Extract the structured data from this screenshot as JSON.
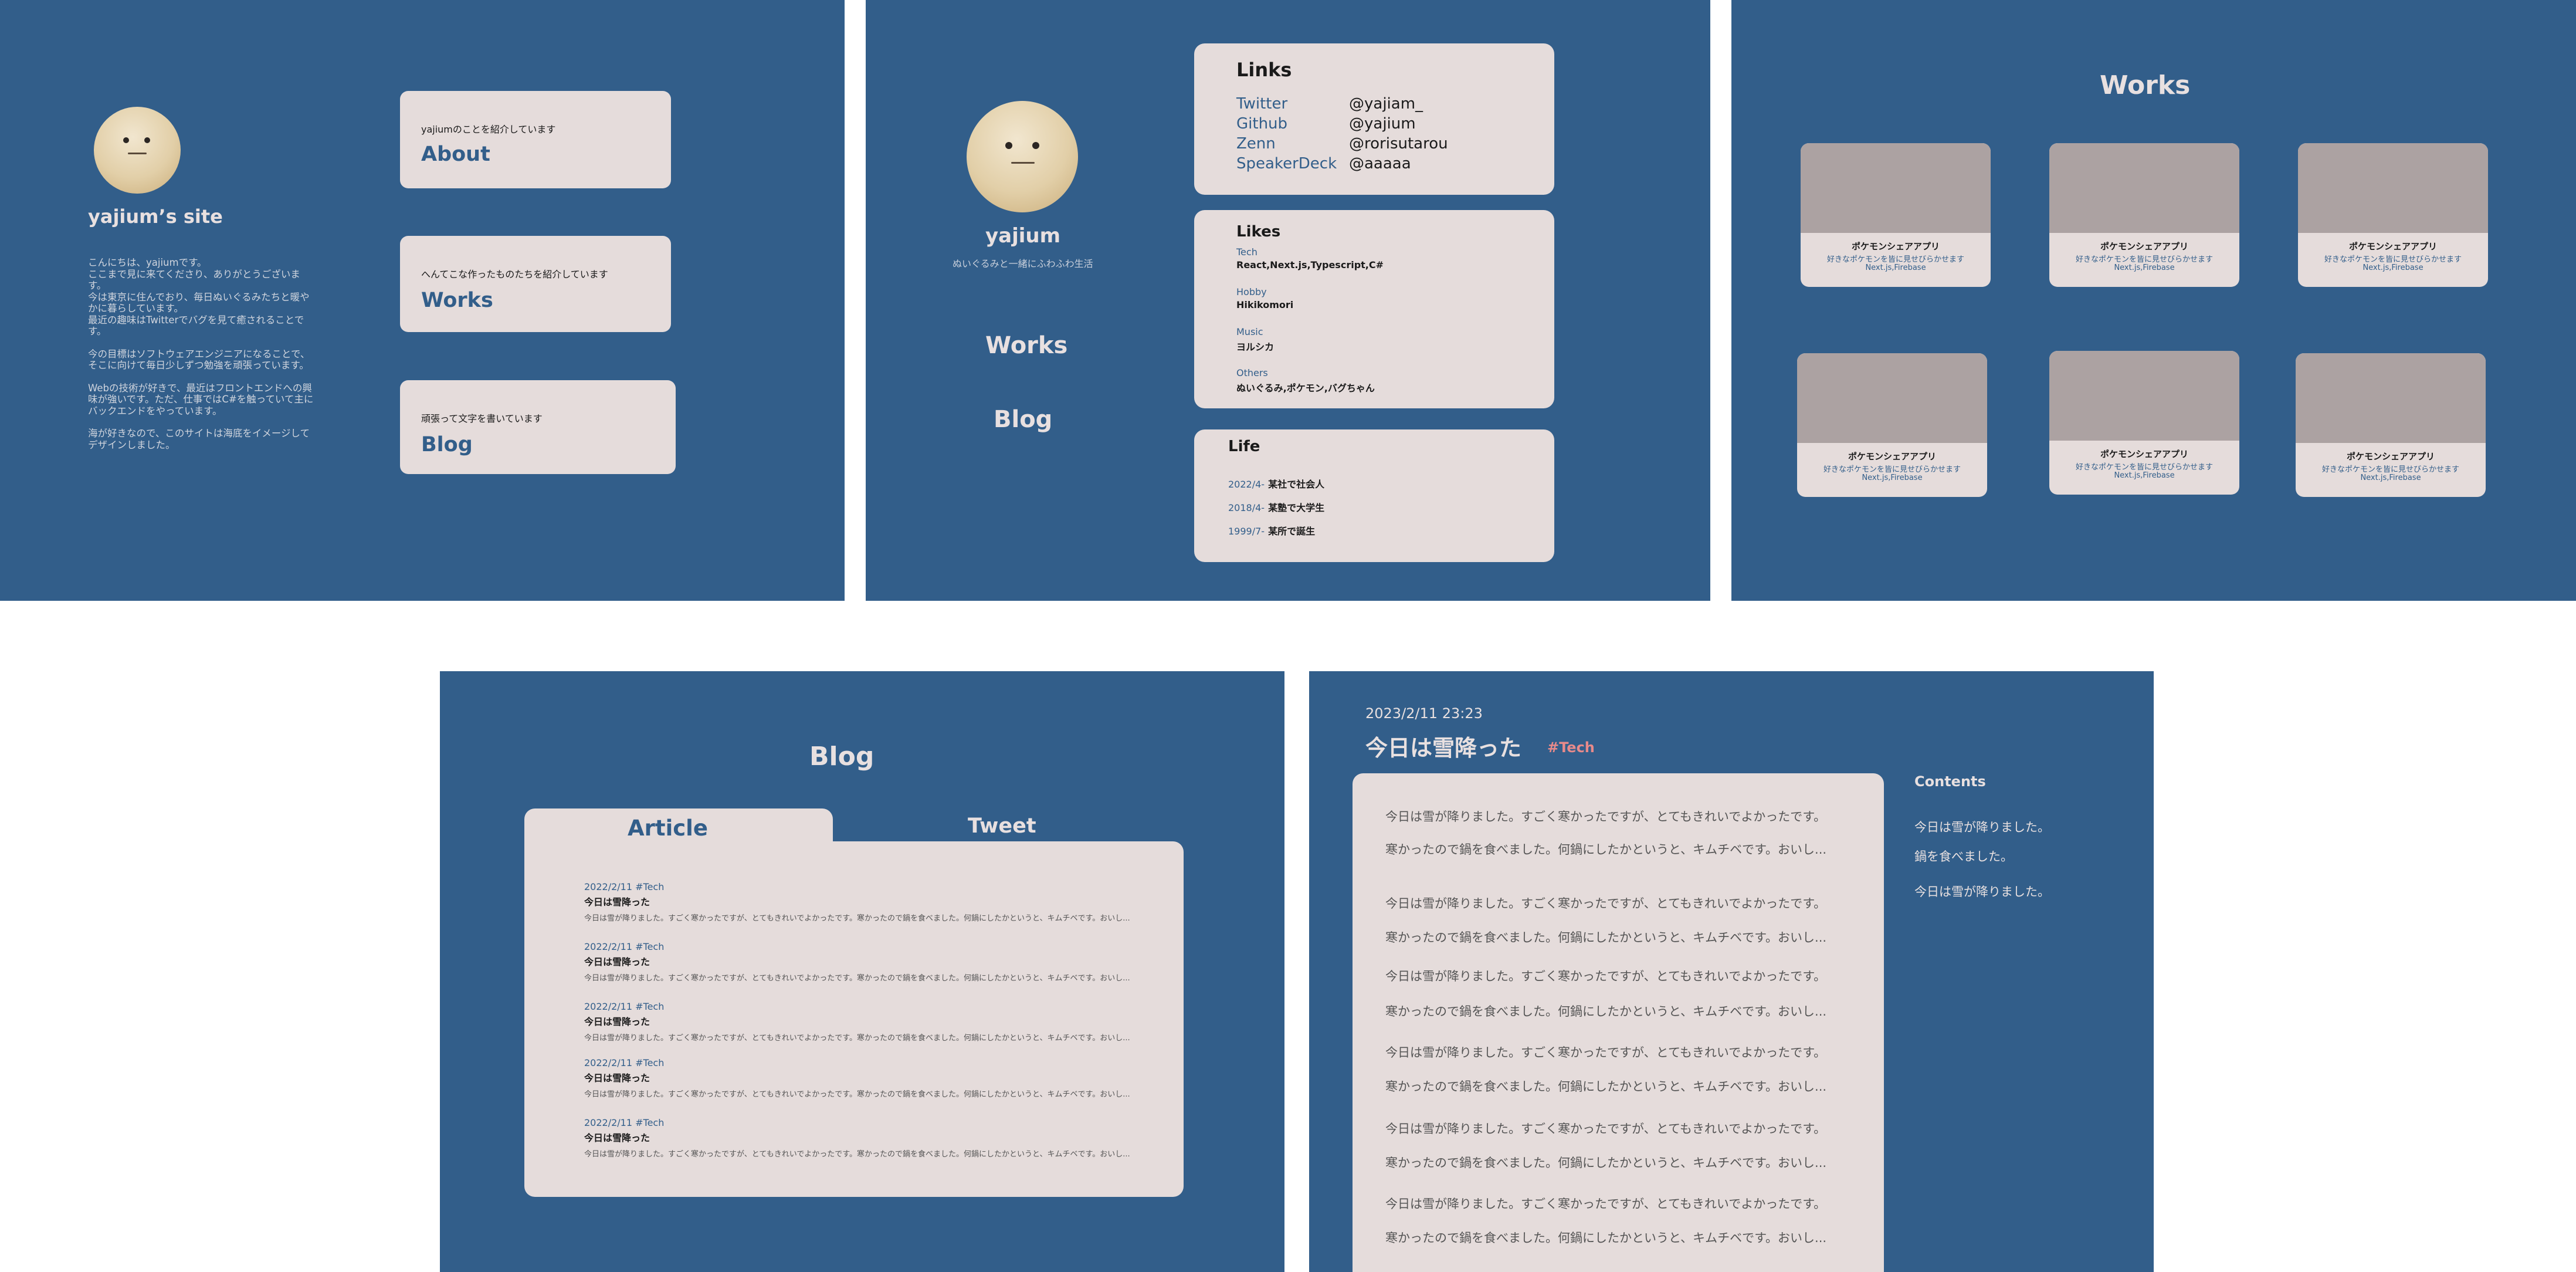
{
  "home": {
    "site_title": "yajium’s site",
    "intro": [
      "こんにちは、yajiumです。\nここまで見に来てくださり、ありがとうございます。\n今は東京に住んでおり、毎日ぬいぐるみたちと暖やかに暮らしています。\n最近の趣味はTwitterでバグを見て癒されることです。",
      "今の目標はソフトウェアエンジニアになることで、そこに向けて毎日少しずつ勉強を頑張っています。",
      "Webの技術が好きで、最近はフロントエンドへの興味が強いです。ただ、仕事ではC#を触っていて主にバックエンドをやっています。",
      "海が好きなので、このサイトは海底をイメージしてデザインしました。"
    ],
    "nav": [
      {
        "sub": "yajiumのことを紹介しています",
        "label": "About"
      },
      {
        "sub": "へんてこな作ったものたちを紹介しています",
        "label": "Works"
      },
      {
        "sub": "頑張って文字を書いています",
        "label": "Blog"
      }
    ]
  },
  "about": {
    "name": "yajium",
    "tagline": "ぬいぐるみと一緒にふわふわ生活",
    "nav": [
      "Works",
      "Blog"
    ],
    "links_title": "Links",
    "links": [
      {
        "name": "Twitter",
        "value": "@yajiam_"
      },
      {
        "name": "Github",
        "value": "@yajium"
      },
      {
        "name": "Zenn",
        "value": "@rorisutarou"
      },
      {
        "name": "SpeakerDeck",
        "value": "@aaaaa"
      }
    ],
    "likes_title": "Likes",
    "likes": [
      {
        "cat": "Tech",
        "value": "React,Next.js,Typescript,C#"
      },
      {
        "cat": "Hobby",
        "value": "Hikikomori"
      },
      {
        "cat": "Music",
        "value": "ヨルシカ"
      },
      {
        "cat": "Others",
        "value": "ぬいぐるみ,ポケモン,バグちゃん"
      }
    ],
    "life_title": "Life",
    "life": [
      {
        "date": "2022/4-",
        "text": "某社で社会人"
      },
      {
        "date": "2018/4-",
        "text": "某塾で大学生"
      },
      {
        "date": "1999/7-",
        "text": "某所で誕生"
      }
    ]
  },
  "works": {
    "title": "Works",
    "items": [
      {
        "title": "ポケモンシェアアプリ",
        "desc": "好きなポケモンを皆に見せびらかせます",
        "tech": "Next.js,Firebase"
      },
      {
        "title": "ポケモンシェアアプリ",
        "desc": "好きなポケモンを皆に見せびらかせます",
        "tech": "Next.js,Firebase"
      },
      {
        "title": "ポケモンシェアアプリ",
        "desc": "好きなポケモンを皆に見せびらかせます",
        "tech": "Next.js,Firebase"
      },
      {
        "title": "ポケモンシェアアプリ",
        "desc": "好きなポケモンを皆に見せびらかせます",
        "tech": "Next.js,Firebase"
      },
      {
        "title": "ポケモンシェアアプリ",
        "desc": "好きなポケモンを皆に見せびらかせます",
        "tech": "Next.js,Firebase"
      },
      {
        "title": "ポケモンシェアアプリ",
        "desc": "好きなポケモンを皆に見せびらかせます",
        "tech": "Next.js,Firebase"
      }
    ]
  },
  "blog": {
    "title": "Blog",
    "tabs": [
      "Article",
      "Tweet"
    ],
    "articles": [
      {
        "meta": "2022/2/11 #Tech",
        "title": "今日は雪降った",
        "excerpt": "今日は雪が降りました。すごく寒かったですが、とてもきれいでよかったです。寒かったので鍋を食べました。何鍋にしたかというと、キムチベです。おいし..."
      },
      {
        "meta": "2022/2/11 #Tech",
        "title": "今日は雪降った",
        "excerpt": "今日は雪が降りました。すごく寒かったですが、とてもきれいでよかったです。寒かったので鍋を食べました。何鍋にしたかというと、キムチベです。おいし..."
      },
      {
        "meta": "2022/2/11 #Tech",
        "title": "今日は雪降った",
        "excerpt": "今日は雪が降りました。すごく寒かったですが、とてもきれいでよかったです。寒かったので鍋を食べました。何鍋にしたかというと、キムチベです。おいし..."
      },
      {
        "meta": "2022/2/11 #Tech",
        "title": "今日は雪降った",
        "excerpt": "今日は雪が降りました。すごく寒かったですが、とてもきれいでよかったです。寒かったので鍋を食べました。何鍋にしたかというと、キムチベです。おいし..."
      },
      {
        "meta": "2022/2/11 #Tech",
        "title": "今日は雪降った",
        "excerpt": "今日は雪が降りました。すごく寒かったですが、とてもきれいでよかったです。寒かったので鍋を食べました。何鍋にしたかというと、キムチベです。おいし..."
      }
    ]
  },
  "post": {
    "datetime": "2023/2/11  23:23",
    "title": "今日は雪降った",
    "tag": "#Tech",
    "paragraphs": [
      "今日は雪が降りました。すごく寒かったですが、とてもきれいでよかったです。",
      "寒かったので鍋を食べました。何鍋にしたかというと、キムチベです。おいし...",
      "今日は雪が降りました。すごく寒かったですが、とてもきれいでよかったです。",
      "寒かったので鍋を食べました。何鍋にしたかというと、キムチベです。おいし...",
      "今日は雪が降りました。すごく寒かったですが、とてもきれいでよかったです。",
      "寒かったので鍋を食べました。何鍋にしたかというと、キムチベです。おいし...",
      "今日は雪が降りました。すごく寒かったですが、とてもきれいでよかったです。",
      "寒かったので鍋を食べました。何鍋にしたかというと、キムチベです。おいし...",
      "今日は雪が降りました。すごく寒かったですが、とてもきれいでよかったです。",
      "寒かったので鍋を食べました。何鍋にしたかというと、キムチベです。おいし...",
      "今日は雪が降りました。すごく寒かったですが、とてもきれいでよかったです。",
      "寒かったので鍋を食べました。何鍋にしたかというと、キムチベです。おいし..."
    ],
    "toc_title": "Contents",
    "toc": [
      "今日は雪が降りました。",
      "鍋を食べました。",
      "今日は雪が降りました。"
    ]
  },
  "colors": {
    "background": "#325e8a",
    "card": "#e5dcdb",
    "thumb": "#aca2a2",
    "tag": "#e88a8a",
    "accent": "#325e8a"
  }
}
